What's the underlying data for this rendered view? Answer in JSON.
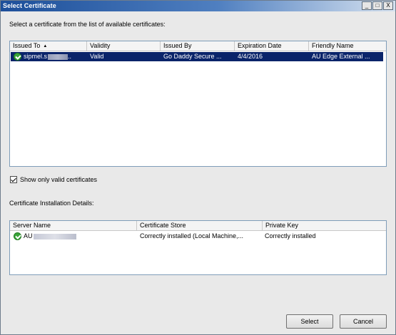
{
  "window": {
    "title": "Select Certificate",
    "controls": {
      "minimize": "_",
      "maximize": "□",
      "close": "X"
    }
  },
  "instruction": "Select a certificate from the list of available certificates:",
  "cert_list": {
    "columns": [
      "Issued To",
      "Validity",
      "Issued By",
      "Expiration Date",
      "Friendly Name"
    ],
    "sort_indicator": "▲",
    "rows": [
      {
        "issued_to": "sipmel.s",
        "issued_to_suffix": "..",
        "validity": "Valid",
        "issued_by": "Go Daddy Secure ...",
        "expiration": "4/4/2016",
        "friendly_name": "AU Edge External ..."
      }
    ]
  },
  "show_valid_only": {
    "label": "Show only valid certificates",
    "checked": true
  },
  "details_label": "Certificate Installation Details:",
  "install_list": {
    "columns": [
      "Server Name",
      "Certificate Store",
      "Private Key"
    ],
    "rows": [
      {
        "server": "AU",
        "store": "Correctly installed (Local Machine,...",
        "private_key": "Correctly installed"
      }
    ]
  },
  "buttons": {
    "select": "Select",
    "cancel": "Cancel"
  }
}
